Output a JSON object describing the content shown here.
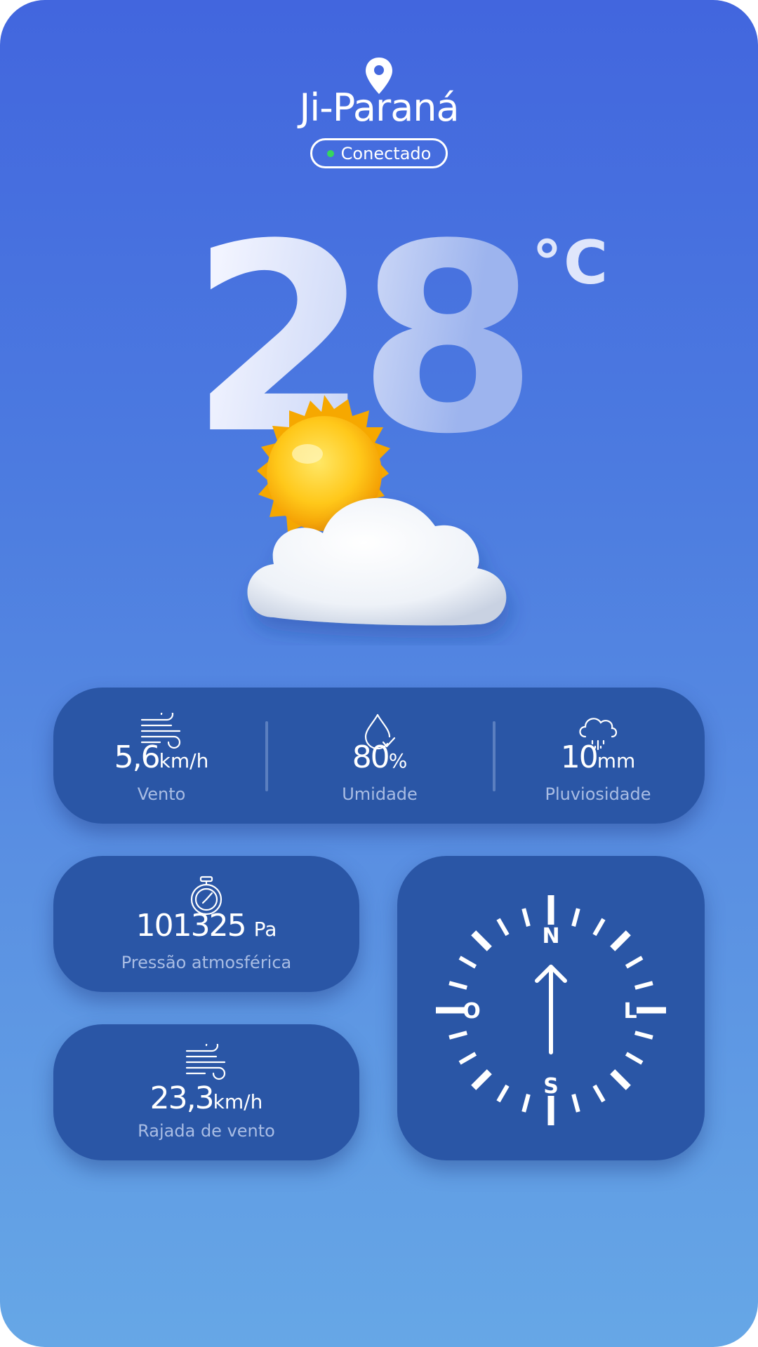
{
  "location": {
    "city": "Ji-Paraná",
    "status": "Conectado",
    "status_color": "#36d65e"
  },
  "current": {
    "temperature": "28",
    "unit": "°C",
    "condition_icon": "sun-behind-cloud-icon"
  },
  "stats": {
    "wind": {
      "value": "5,6",
      "unit": "km/h",
      "label": "Vento",
      "icon": "wind-icon"
    },
    "humidity": {
      "value": "80",
      "unit": "%",
      "label": "Umidade",
      "icon": "water-drop-icon"
    },
    "rain": {
      "value": "10",
      "unit": "mm",
      "label": "Pluviosidade",
      "icon": "rain-cloud-icon"
    },
    "pressure": {
      "value": "101325",
      "unit": "Pa",
      "label": "Pressão atmosférica",
      "icon": "barometer-icon"
    },
    "gust": {
      "value": "23,3",
      "unit": "km/h",
      "label": "Rajada de vento",
      "icon": "wind-icon"
    }
  },
  "compass": {
    "north": "N",
    "east": "L",
    "south": "S",
    "west": "O",
    "wind_direction_deg": 0
  },
  "colors": {
    "card": "#2a56a6",
    "muted_text": "#a9bde4",
    "gradient_top": "#4266de",
    "gradient_bottom": "#66a7e6"
  }
}
